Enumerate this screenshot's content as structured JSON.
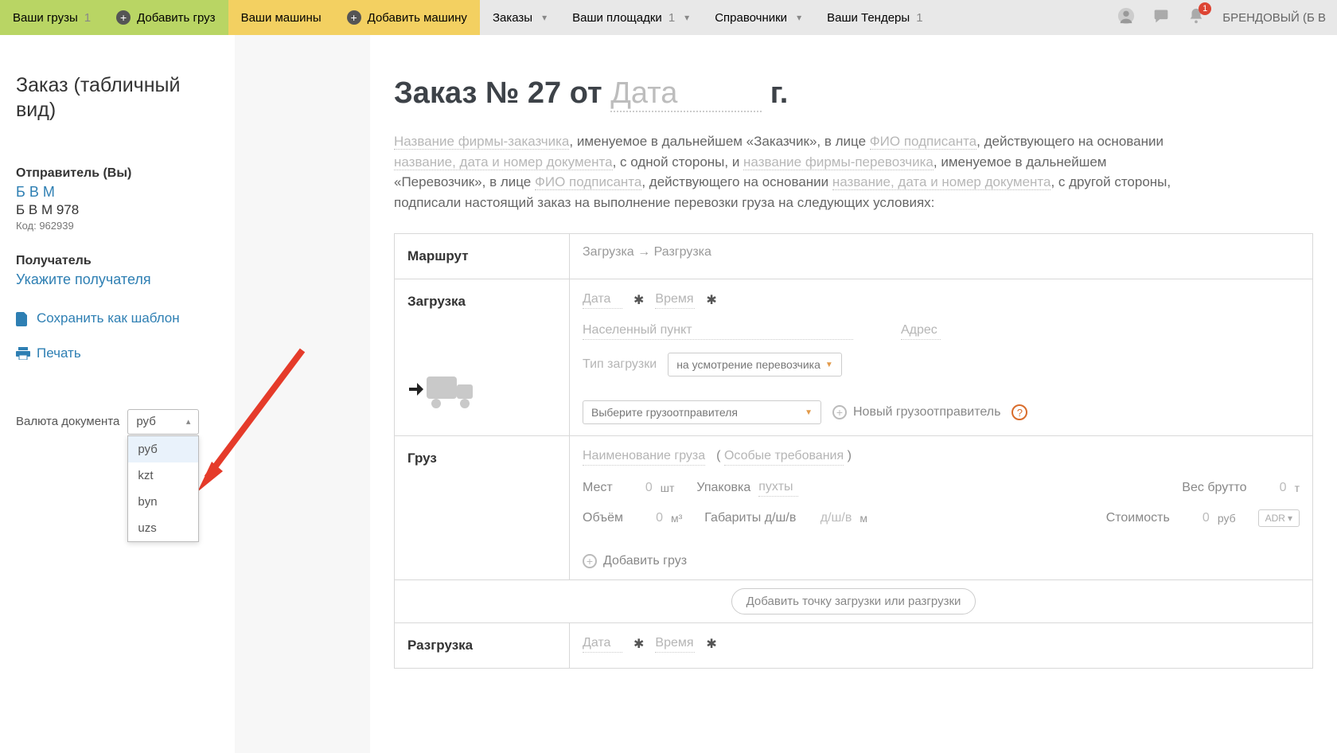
{
  "nav": {
    "cargo": "Ваши грузы",
    "cargo_count": "1",
    "add_cargo": "Добавить груз",
    "vehicles": "Ваши машины",
    "add_vehicle": "Добавить машину",
    "orders": "Заказы",
    "sites": "Ваши площадки",
    "sites_count": "1",
    "refs": "Справочники",
    "tenders": "Ваши Тендеры",
    "tenders_count": "1",
    "notif_badge": "1",
    "user": "БРЕНДОВЫЙ (Б В"
  },
  "sidebar": {
    "title": "Заказ (табличный вид)",
    "sender_label": "Отправитель (Вы)",
    "sender_name": "Б В М",
    "sender_sub": "Б В М 978",
    "sender_code": "Код: 962939",
    "receiver_label": "Получатель",
    "receiver_link": "Укажите получателя",
    "save_tpl": "Сохранить как шаблон",
    "print": "Печать",
    "currency_label": "Валюта документа",
    "currency_value": "руб",
    "currency_options": [
      "руб",
      "kzt",
      "byn",
      "uzs"
    ]
  },
  "main": {
    "title_prefix": "Заказ № 27 от",
    "title_date_ph": "Дата",
    "title_suffix": "г.",
    "contract": {
      "t1": "Название фирмы-заказчика",
      "t2": ", именуемое в дальнейшем «Заказчик», в лице ",
      "t3": "ФИО подписанта",
      "t4": ", действующего на основании ",
      "t5": "название, дата и номер документа",
      "t6": ", с одной стороны, и ",
      "t7": "название фирмы-перевозчика",
      "t8": ", именуемое в дальнейшем «Перевозчик», в лице ",
      "t9": "ФИО подписанта",
      "t10": ", действующего на основании ",
      "t11": "название, дата и номер документа",
      "t12": ", с другой стороны, подписали настоящий заказ на выполнение перевозки груза на следующих условиях:"
    },
    "route_label": "Маршрут",
    "route_value": "Загрузка → Разгрузка",
    "loading_label": "Загрузка",
    "date_ph": "Дата",
    "time_ph": "Время",
    "city_ph": "Населенный пункт",
    "address_ph": "Адрес",
    "loadtype_label": "Тип загрузки",
    "loadtype_value": "на усмотрение перевозчика",
    "shipper_select_ph": "Выберите грузоотправителя",
    "new_shipper": "Новый грузоотправитель",
    "cargo_label": "Груз",
    "cargo_name_ph": "Наименование груза",
    "special_req": "Особые требования",
    "places_lbl": "Мест",
    "places_unit": "шт",
    "pack_lbl": "Упаковка",
    "pack_ph": "пухты",
    "weight_lbl": "Вес брутто",
    "weight_unit": "т",
    "volume_lbl": "Объём",
    "volume_unit": "м³",
    "dims_lbl": "Габариты д/ш/в",
    "dims_ph": "д/ш/в",
    "dims_unit": "м",
    "cost_lbl": "Стоимость",
    "cost_unit": "руб",
    "adr_btn": "ADR",
    "zero": "0",
    "add_cargo": "Добавить груз",
    "add_point": "Добавить точку загрузки или разгрузки",
    "unloading_label": "Разгрузка"
  }
}
